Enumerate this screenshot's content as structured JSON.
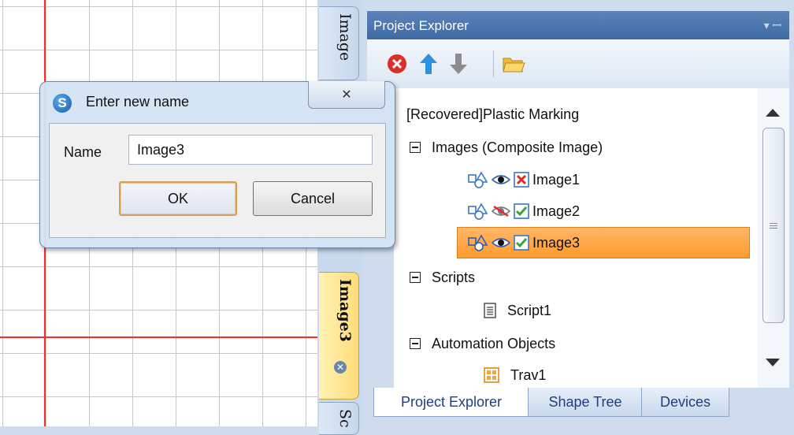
{
  "dialog": {
    "title": "Enter new name",
    "close_glyph": "✕",
    "name_label": "Name",
    "name_value": "Image3",
    "ok_label": "OK",
    "cancel_label": "Cancel"
  },
  "document_tabs": [
    {
      "label": "Image",
      "active": false
    },
    {
      "label": "Image3",
      "active": true
    },
    {
      "label": "Sc",
      "active": false
    }
  ],
  "panel": {
    "title": "Project Explorer",
    "pin_glyph": "▾ ⊥",
    "toolbar": [
      "delete-icon",
      "move-up-icon",
      "move-down-icon",
      "open-folder-icon"
    ]
  },
  "tree": {
    "root": "[Recovered]Plastic Marking",
    "images_group": "Images (Composite Image)",
    "images": [
      {
        "label": "Image1",
        "visible": true,
        "enabled": false
      },
      {
        "label": "Image2",
        "visible": false,
        "enabled": true
      },
      {
        "label": "Image3",
        "visible": true,
        "enabled": true,
        "selected": true
      }
    ],
    "scripts_group": "Scripts",
    "scripts": [
      {
        "label": "Script1"
      }
    ],
    "automation_group": "Automation Objects",
    "automation": [
      {
        "label": "Trav1"
      }
    ]
  },
  "bottom_tabs": [
    {
      "label": "Project Explorer",
      "active": true
    },
    {
      "label": "Shape Tree",
      "active": false
    },
    {
      "label": "Devices",
      "active": false
    }
  ],
  "colors": {
    "selection": "#ff9a2e",
    "title_bar": "#4a74ad",
    "guide_line": "#ff2a2a"
  }
}
